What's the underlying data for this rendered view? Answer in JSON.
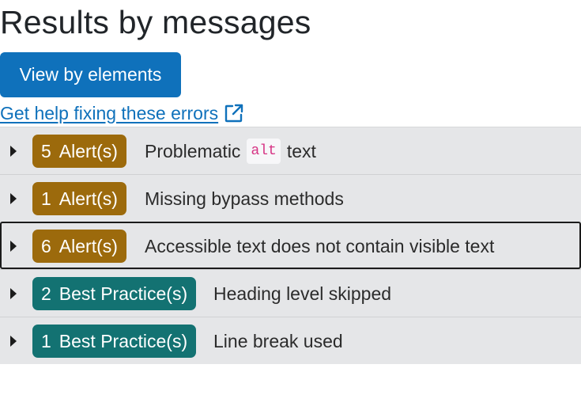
{
  "header": {
    "title": "Results by messages",
    "view_button_label": "View by elements",
    "help_link_text": "Get help fixing these errors"
  },
  "results": [
    {
      "count": "5",
      "badge_label": "Alert(s)",
      "kind": "alert",
      "message_before": "Problematic",
      "message_code": "alt",
      "message_after": "text"
    },
    {
      "count": "1",
      "badge_label": "Alert(s)",
      "kind": "alert",
      "message": "Missing bypass methods"
    },
    {
      "count": "6",
      "badge_label": "Alert(s)",
      "kind": "alert",
      "message": "Accessible text does not contain visible text"
    },
    {
      "count": "2",
      "badge_label": "Best Practice(s)",
      "kind": "best-practice",
      "message": "Heading level skipped"
    },
    {
      "count": "1",
      "badge_label": "Best Practice(s)",
      "kind": "best-practice",
      "message": "Line break used"
    }
  ],
  "colors": {
    "primary": "#0f71bb",
    "alert_badge": "#9c6a0c",
    "best_practice_badge": "#137272",
    "row_background": "#e5e6e8",
    "code_text": "#d63384"
  },
  "icons": {
    "help_link": "external-link-icon",
    "row_toggle": "caret-right-icon"
  }
}
